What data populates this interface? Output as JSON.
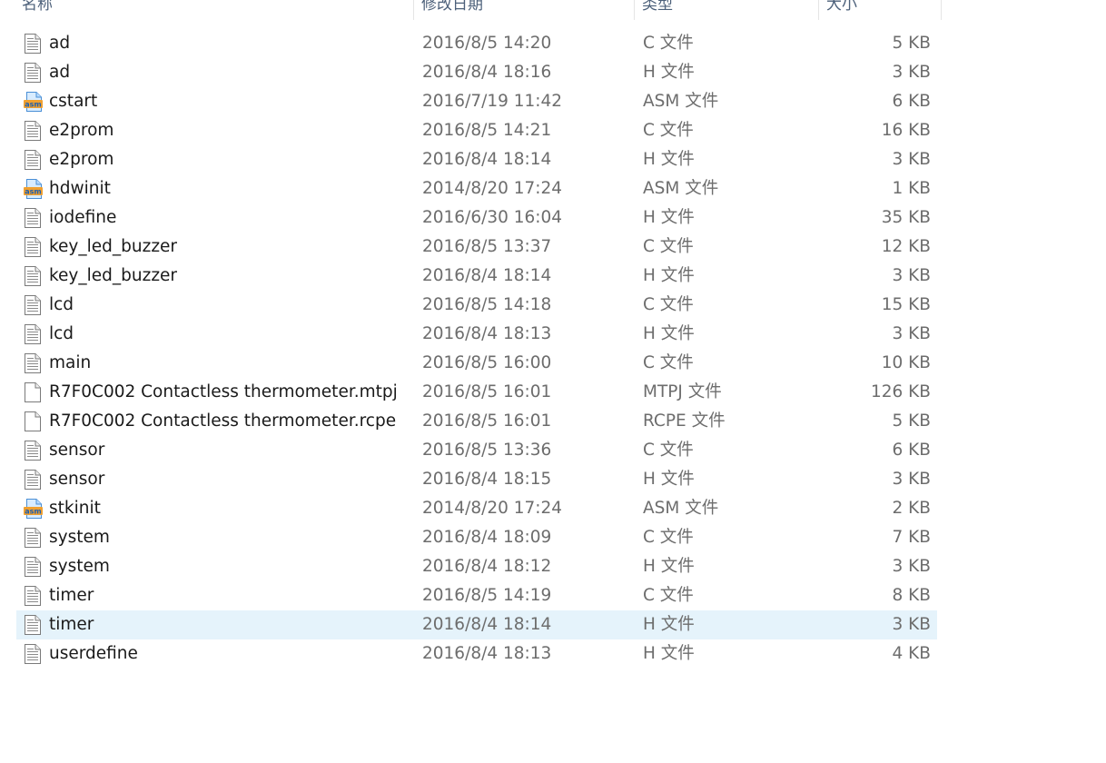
{
  "columns": {
    "name": "名称",
    "date": "修改日期",
    "type": "类型",
    "size": "大小"
  },
  "files": [
    {
      "name": "ad",
      "date": "2016/8/5 14:20",
      "type": "C 文件",
      "size": "5 KB",
      "icon": "text-file-icon"
    },
    {
      "name": "ad",
      "date": "2016/8/4 18:16",
      "type": "H 文件",
      "size": "3 KB",
      "icon": "text-file-icon"
    },
    {
      "name": "cstart",
      "date": "2016/7/19 11:42",
      "type": "ASM 文件",
      "size": "6 KB",
      "icon": "asm-file-icon"
    },
    {
      "name": "e2prom",
      "date": "2016/8/5 14:21",
      "type": "C 文件",
      "size": "16 KB",
      "icon": "text-file-icon"
    },
    {
      "name": "e2prom",
      "date": "2016/8/4 18:14",
      "type": "H 文件",
      "size": "3 KB",
      "icon": "text-file-icon"
    },
    {
      "name": "hdwinit",
      "date": "2014/8/20 17:24",
      "type": "ASM 文件",
      "size": "1 KB",
      "icon": "asm-file-icon"
    },
    {
      "name": "iodefine",
      "date": "2016/6/30 16:04",
      "type": "H 文件",
      "size": "35 KB",
      "icon": "text-file-icon"
    },
    {
      "name": "key_led_buzzer",
      "date": "2016/8/5 13:37",
      "type": "C 文件",
      "size": "12 KB",
      "icon": "text-file-icon"
    },
    {
      "name": "key_led_buzzer",
      "date": "2016/8/4 18:14",
      "type": "H 文件",
      "size": "3 KB",
      "icon": "text-file-icon"
    },
    {
      "name": "lcd",
      "date": "2016/8/5 14:18",
      "type": "C 文件",
      "size": "15 KB",
      "icon": "text-file-icon"
    },
    {
      "name": "lcd",
      "date": "2016/8/4 18:13",
      "type": "H 文件",
      "size": "3 KB",
      "icon": "text-file-icon"
    },
    {
      "name": "main",
      "date": "2016/8/5 16:00",
      "type": "C 文件",
      "size": "10 KB",
      "icon": "text-file-icon"
    },
    {
      "name": "R7F0C002 Contactless thermometer.mtpj",
      "date": "2016/8/5 16:01",
      "type": "MTPJ 文件",
      "size": "126 KB",
      "icon": "blank-file-icon"
    },
    {
      "name": "R7F0C002 Contactless thermometer.rcpe",
      "date": "2016/8/5 16:01",
      "type": "RCPE 文件",
      "size": "5 KB",
      "icon": "blank-file-icon"
    },
    {
      "name": "sensor",
      "date": "2016/8/5 13:36",
      "type": "C 文件",
      "size": "6 KB",
      "icon": "text-file-icon"
    },
    {
      "name": "sensor",
      "date": "2016/8/4 18:15",
      "type": "H 文件",
      "size": "3 KB",
      "icon": "text-file-icon"
    },
    {
      "name": "stkinit",
      "date": "2014/8/20 17:24",
      "type": "ASM 文件",
      "size": "2 KB",
      "icon": "asm-file-icon"
    },
    {
      "name": "system",
      "date": "2016/8/4 18:09",
      "type": "C 文件",
      "size": "7 KB",
      "icon": "text-file-icon"
    },
    {
      "name": "system",
      "date": "2016/8/4 18:12",
      "type": "H 文件",
      "size": "3 KB",
      "icon": "text-file-icon"
    },
    {
      "name": "timer",
      "date": "2016/8/5 14:19",
      "type": "C 文件",
      "size": "8 KB",
      "icon": "text-file-icon"
    },
    {
      "name": "timer",
      "date": "2016/8/4 18:14",
      "type": "H 文件",
      "size": "3 KB",
      "icon": "text-file-icon",
      "selected": true
    },
    {
      "name": "userdefine",
      "date": "2016/8/4 18:13",
      "type": "H 文件",
      "size": "4 KB",
      "icon": "text-file-icon"
    }
  ],
  "colors": {
    "selected_row": "#e5f3fb",
    "header_text": "#4c607a",
    "secondary_text": "#6d6d6d"
  }
}
